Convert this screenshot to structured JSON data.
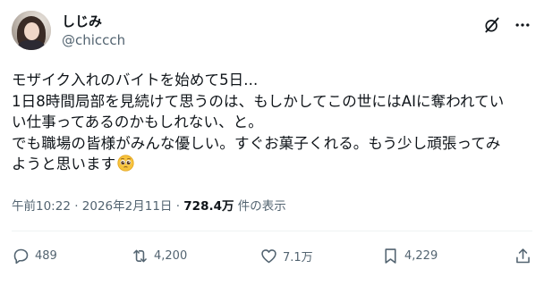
{
  "user": {
    "name": "しじみ",
    "handle": "@chiccch"
  },
  "tweet": {
    "lines": [
      "モザイク入れのバイトを始めて5日...",
      "1日8時間局部を見続けて思うのは、もしかしてこの世にはAIに奪われてい",
      "い仕事ってあるのかもしれない、と。",
      "でも職場の皆様がみんな優しい。すぐお菓子くれる。もう少し頑張ってみ",
      "ようと思います"
    ],
    "emoji": "pleading-face"
  },
  "meta": {
    "time": "午前10:22",
    "separator": " · ",
    "date": "2026年2月11日",
    "views": "728.4万",
    "views_suffix": " 件の表示"
  },
  "actions": {
    "replies": "489",
    "retweets": "4,200",
    "likes": "7.1万",
    "bookmarks": "4,229"
  },
  "icons": {
    "grok": "grok-icon",
    "more": "more-icon",
    "reply": "reply-icon",
    "retweet": "retweet-icon",
    "like": "heart-icon",
    "bookmark": "bookmark-icon",
    "share": "share-icon"
  },
  "colors": {
    "text": "#0f1419",
    "secondary": "#536471",
    "divider": "#eff3f4"
  }
}
